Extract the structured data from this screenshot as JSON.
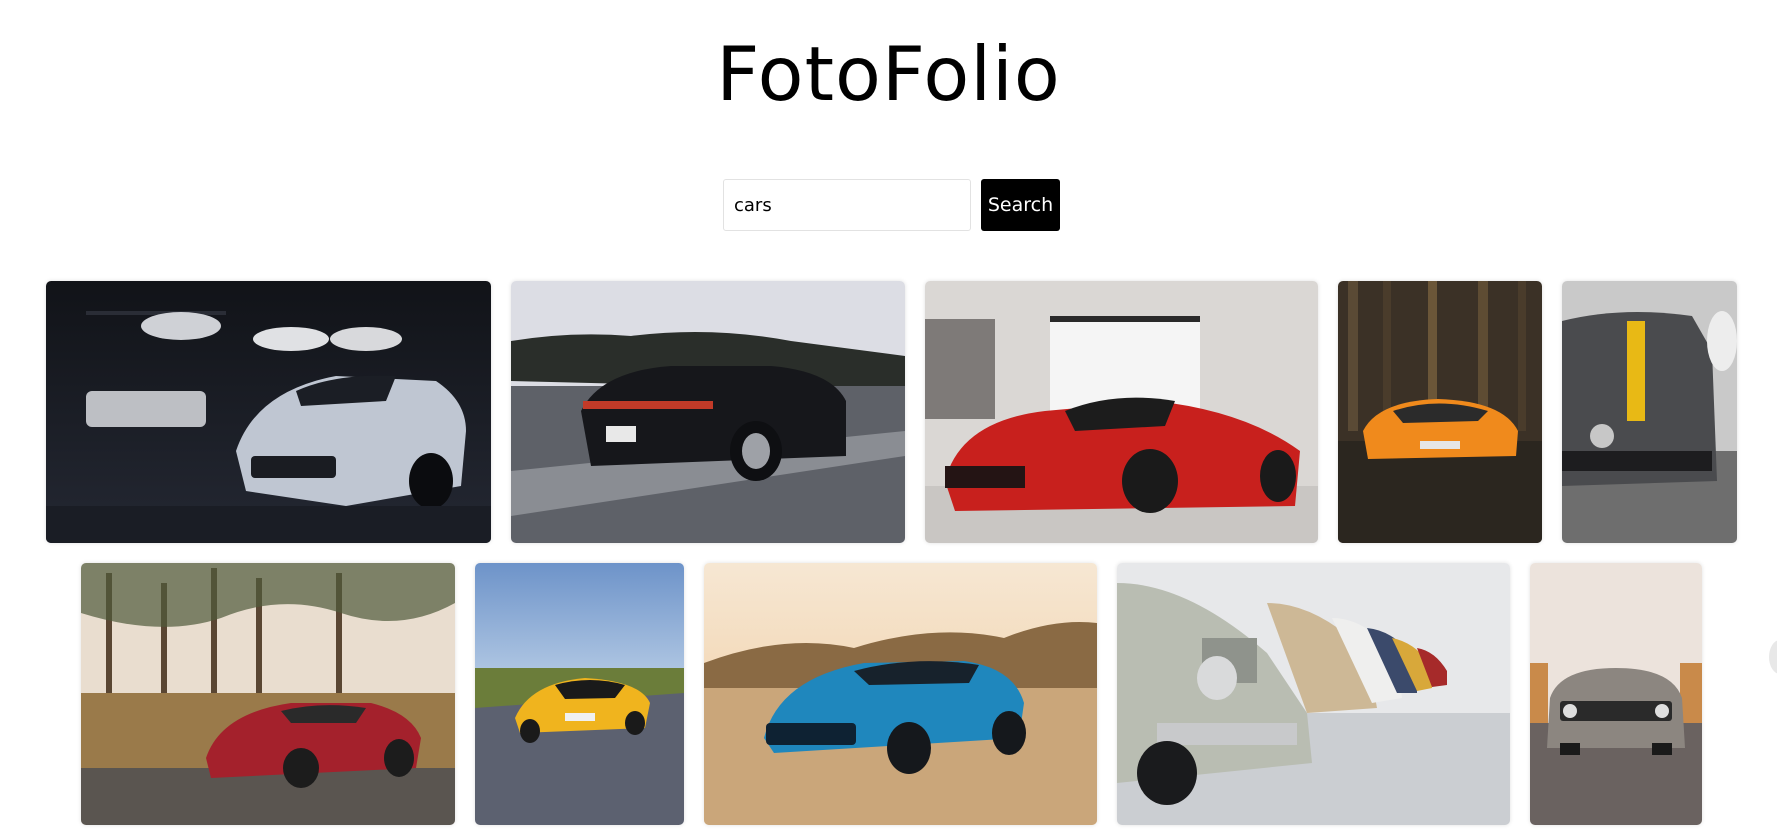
{
  "app": {
    "title": "FotoFolio"
  },
  "search": {
    "value": "cars",
    "button_label": "Search"
  },
  "gallery": {
    "photos": [
      {
        "name": "white camaro in dark garage",
        "icon": "photo-icon"
      },
      {
        "name": "black porsche on highway",
        "icon": "photo-icon"
      },
      {
        "name": "red ferrari in showroom",
        "icon": "photo-icon"
      },
      {
        "name": "orange lamborghini in forest",
        "icon": "photo-icon"
      },
      {
        "name": "grey mercedes with yellow stripe",
        "icon": "photo-icon"
      },
      {
        "name": "red mercedes amg in forest",
        "icon": "photo-icon"
      },
      {
        "name": "yellow mercedes amg on road",
        "icon": "photo-icon"
      },
      {
        "name": "blue camaro in desert",
        "icon": "photo-icon"
      },
      {
        "name": "row of vintage bmw cars",
        "icon": "photo-icon"
      },
      {
        "name": "grey dodge challenger front",
        "icon": "photo-icon"
      }
    ]
  },
  "colors": {
    "button_bg": "#000000",
    "button_text": "#ffffff",
    "background": "#ffffff"
  }
}
